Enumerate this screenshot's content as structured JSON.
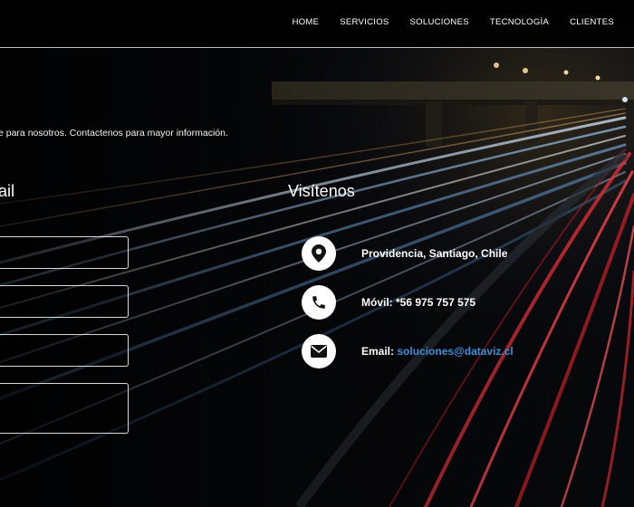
{
  "nav": {
    "items": [
      {
        "label": "HOME"
      },
      {
        "label": "SERVICIOS"
      },
      {
        "label": "SOLUCIONES"
      },
      {
        "label": "TECNOLOGÍA"
      },
      {
        "label": "CLIENTES"
      }
    ]
  },
  "intro": {
    "text": "e para nosotros. Contactenos para mayor información."
  },
  "form": {
    "title": "ail",
    "fields": [
      {
        "value": "",
        "placeholder": ""
      },
      {
        "value": "",
        "placeholder": ""
      },
      {
        "value": "",
        "placeholder": ""
      },
      {
        "value": "",
        "placeholder": ""
      }
    ]
  },
  "visit": {
    "title": "Visítenos",
    "items": [
      {
        "icon": "map-pin-icon",
        "label": "",
        "value": "Providencia, Santiago, Chile"
      },
      {
        "icon": "phone-icon",
        "label": "Móvil:",
        "value": "*56 975 757 575"
      },
      {
        "icon": "envelope-icon",
        "label": "Email:",
        "value": "soluciones@dataviz.cl"
      }
    ]
  },
  "colors": {
    "background": "#050608",
    "link": "#3a8fd8",
    "text": "#ffffff"
  }
}
